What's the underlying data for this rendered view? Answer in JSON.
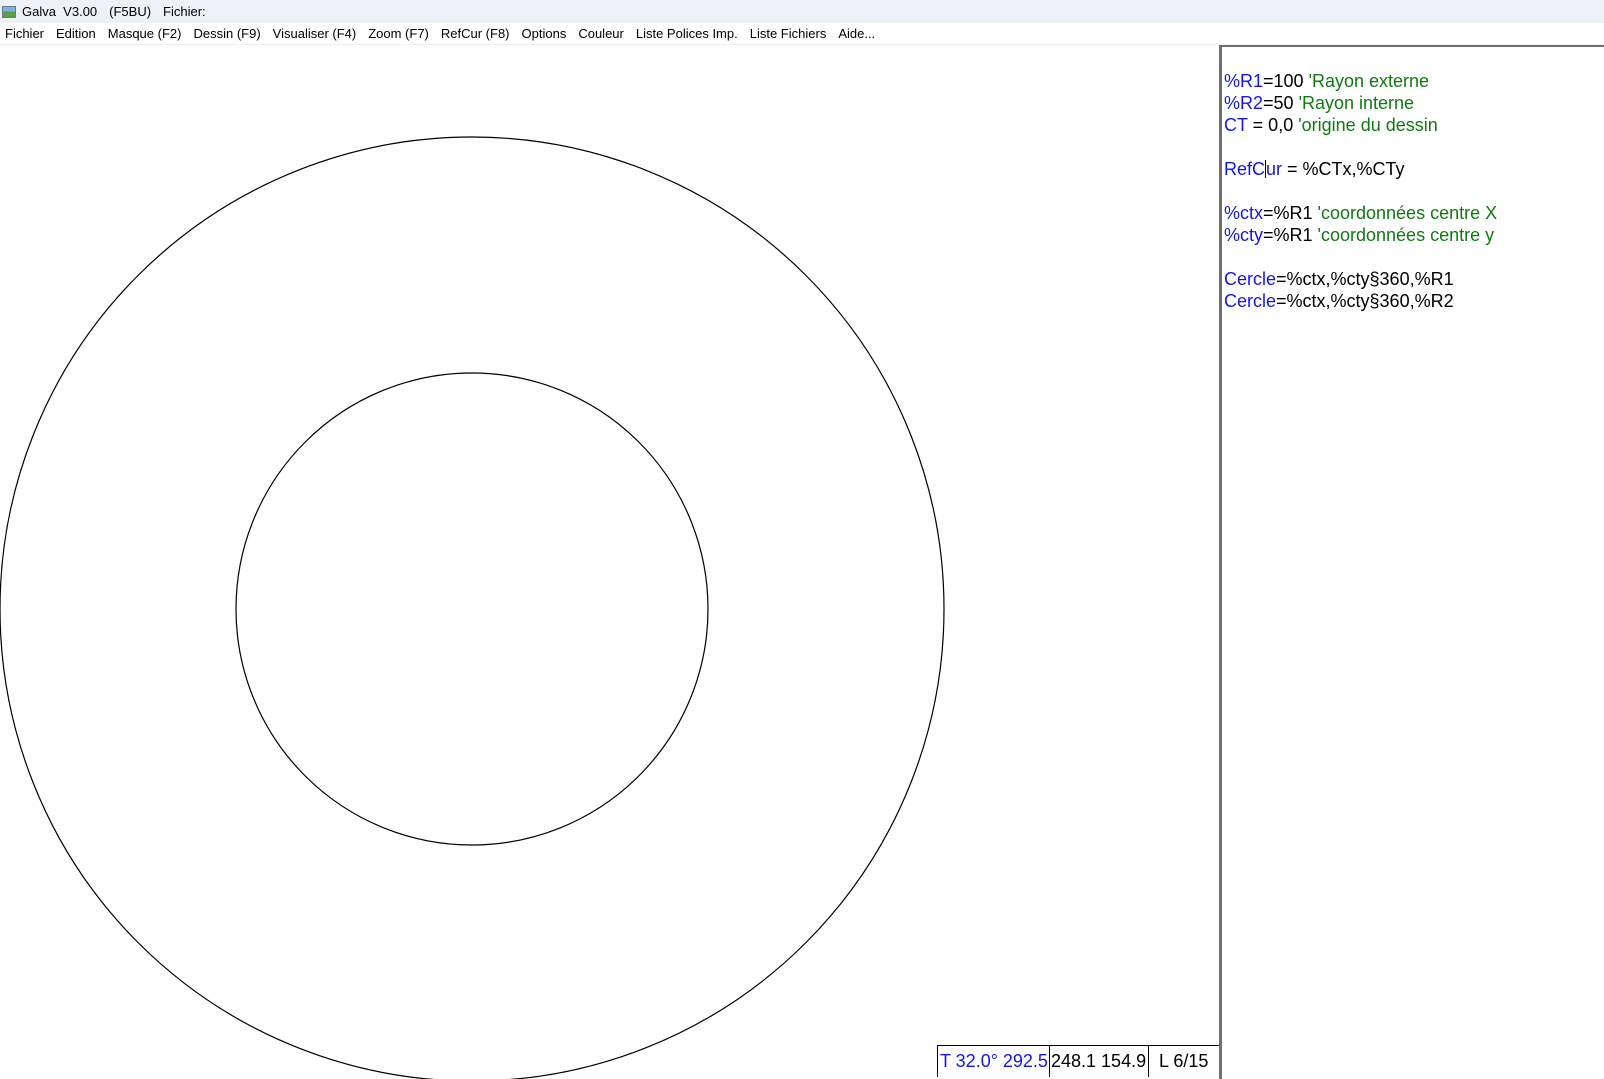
{
  "window": {
    "title_segments": [
      "Galva  V3.00",
      "(F5BU)",
      "Fichier:"
    ]
  },
  "menu": {
    "items": [
      "Fichier",
      "Edition",
      "Masque (F2)",
      "Dessin (F9)",
      "Visualiser (F4)",
      "Zoom (F7)",
      "RefCur (F8)",
      "Options",
      "Couleur",
      "Liste Polices Imp.",
      "Liste Fichiers",
      "Aide..."
    ]
  },
  "editor": {
    "lines": [
      {
        "kw": "%R1",
        "op": "=100 ",
        "cm": "'Rayon externe"
      },
      {
        "kw": "%R2",
        "op": "=50 ",
        "cm": "'Rayon interne"
      },
      {
        "kw": "CT",
        "op": " = 0,0 ",
        "cm": "'origine du dessin"
      },
      {
        "kw": "",
        "op": "",
        "cm": ""
      },
      {
        "kw_a": "RefC",
        "kw_b": "ur",
        "op": " = %CTx,%CTy",
        "cm": ""
      },
      {
        "kw": "",
        "op": "",
        "cm": ""
      },
      {
        "kw": "%ctx",
        "op": "=%R1 ",
        "cm": "'coordonnées centre X"
      },
      {
        "kw": "%cty",
        "op": "=%R1 ",
        "cm": "'coordonnées centre y"
      },
      {
        "kw": "",
        "op": "",
        "cm": ""
      },
      {
        "kw": "Cercle",
        "op": "=%ctx,%cty§360,%R1",
        "cm": ""
      },
      {
        "kw": "Cercle",
        "op": "=%ctx,%cty§360,%R2",
        "cm": ""
      }
    ]
  },
  "status": {
    "angle": "T 32.0°  292.5",
    "coords": "248.1  154.9",
    "line": "L 6/15"
  },
  "drawing": {
    "stroke_color": "#000000",
    "circles": [
      {
        "name": "outer-circle",
        "radius": 100
      },
      {
        "name": "inner-circle",
        "radius": 50
      }
    ]
  },
  "colors": {
    "keyword": "#1515e6",
    "comment": "#0f7a0f",
    "text": "#000000"
  }
}
